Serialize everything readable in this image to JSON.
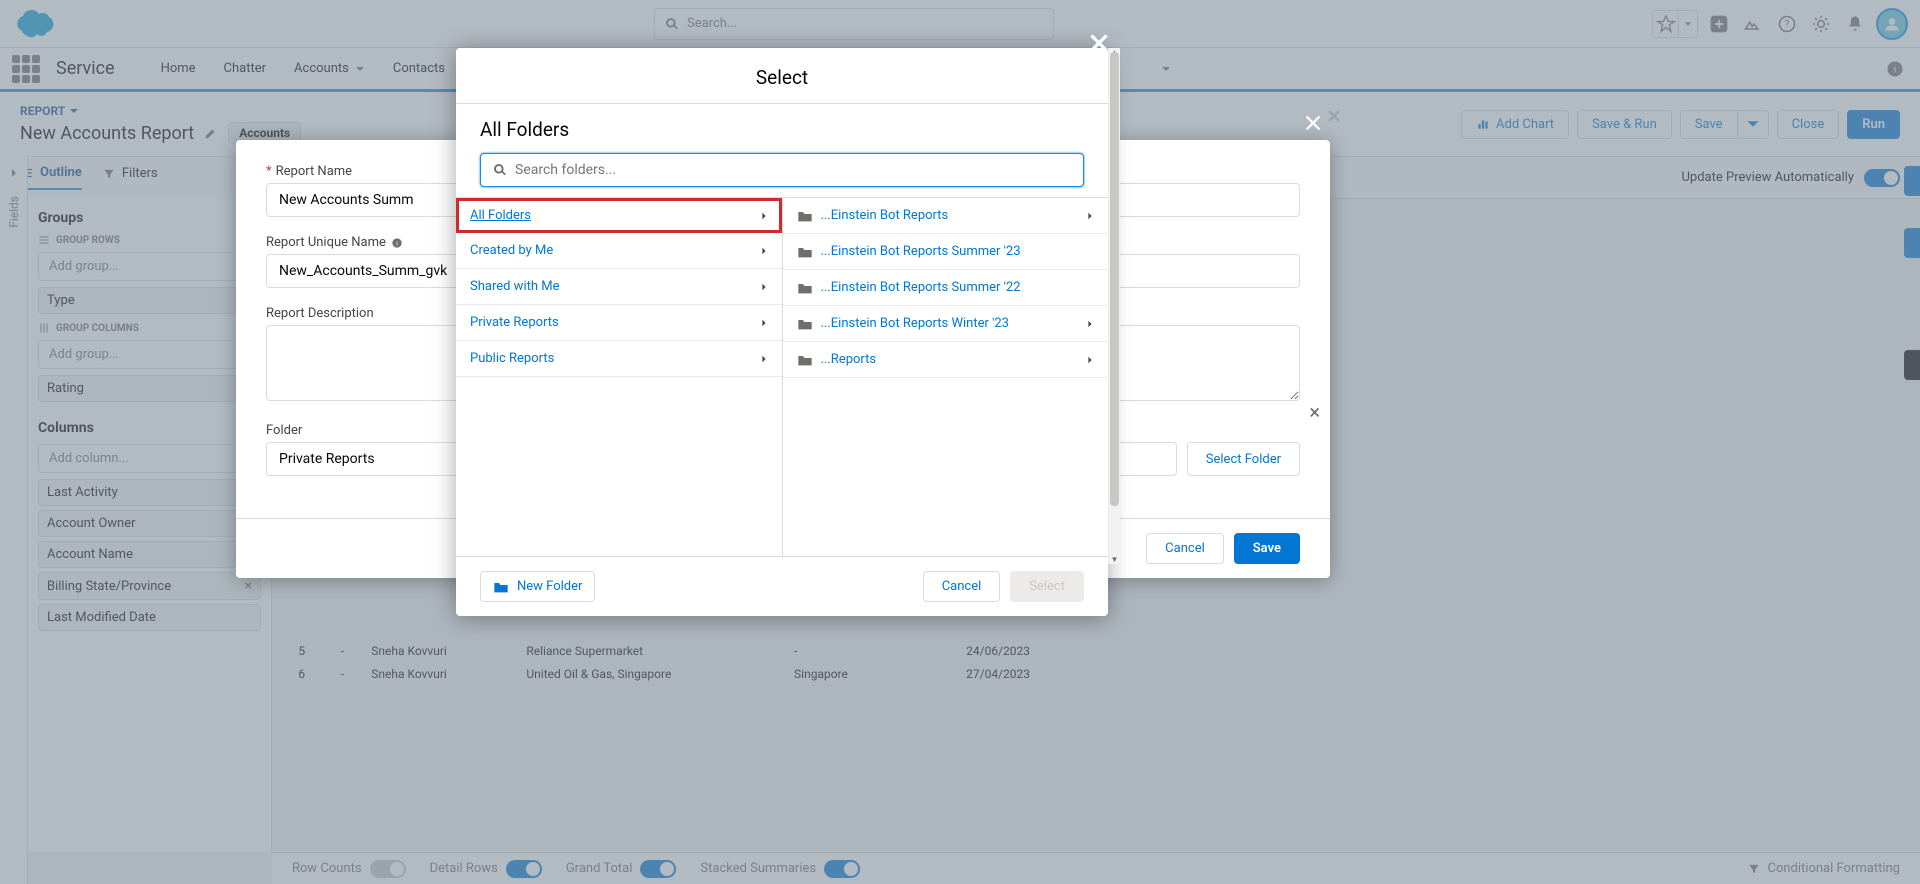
{
  "header": {
    "search_placeholder": "Search...",
    "app_name": "Service",
    "nav": [
      "Home",
      "Chatter",
      "Accounts",
      "Contacts"
    ]
  },
  "report": {
    "label": "REPORT",
    "title": "New Accounts Report",
    "object_badge": "Accounts",
    "actions": {
      "add_chart": "Add Chart",
      "save_run": "Save & Run",
      "save": "Save",
      "close": "Close",
      "run": "Run"
    },
    "update_preview": "Update Preview Automatically"
  },
  "builder": {
    "outline": "Outline",
    "filters": "Filters",
    "groups_title": "Groups",
    "group_rows": "GROUP ROWS",
    "group_cols": "GROUP COLUMNS",
    "add_group": "Add group...",
    "columns_title": "Columns",
    "add_column": "Add column...",
    "group_row_items": [
      "Type",
      "Rating"
    ],
    "column_items": [
      "Last Activity",
      "Account Owner",
      "Account Name",
      "Billing State/Province",
      "Last Modified Date"
    ]
  },
  "fields_tab": "Fields",
  "save_modal": {
    "report_name_label": "Report Name",
    "report_name_value": "New Accounts Summ",
    "unique_name_label": "Report Unique Name",
    "unique_name_value": "New_Accounts_Summ_gvk",
    "description_label": "Report Description",
    "folder_label": "Folder",
    "folder_value": "Private Reports",
    "select_folder": "Select Folder",
    "cancel": "Cancel",
    "save": "Save"
  },
  "select_modal": {
    "title": "Select",
    "subtitle": "All Folders",
    "search_placeholder": "Search folders...",
    "left_items": [
      "All Folders",
      "Created by Me",
      "Shared with Me",
      "Private Reports",
      "Public Reports"
    ],
    "right_items": [
      "...Einstein Bot Reports",
      "...Einstein Bot Reports Summer '23",
      "...Einstein Bot Reports Summer '22",
      "...Einstein Bot Reports Winter '23",
      "...Reports"
    ],
    "new_folder": "New Folder",
    "cancel": "Cancel",
    "select": "Select"
  },
  "footer": {
    "row_counts": "Row Counts",
    "detail_rows": "Detail Rows",
    "grand_total": "Grand Total",
    "stacked": "Stacked Summaries",
    "conditional": "Conditional Formatting"
  },
  "table_rows": [
    {
      "n": "5",
      "dash": "-",
      "owner": "Sneha Kovvuri",
      "acct": "Reliance Supermarket",
      "state": "-",
      "date": "24/06/2023"
    },
    {
      "n": "6",
      "dash": "-",
      "owner": "Sneha Kovvuri",
      "acct": "United Oil & Gas, Singapore",
      "state": "Singapore",
      "date": "27/04/2023"
    }
  ]
}
